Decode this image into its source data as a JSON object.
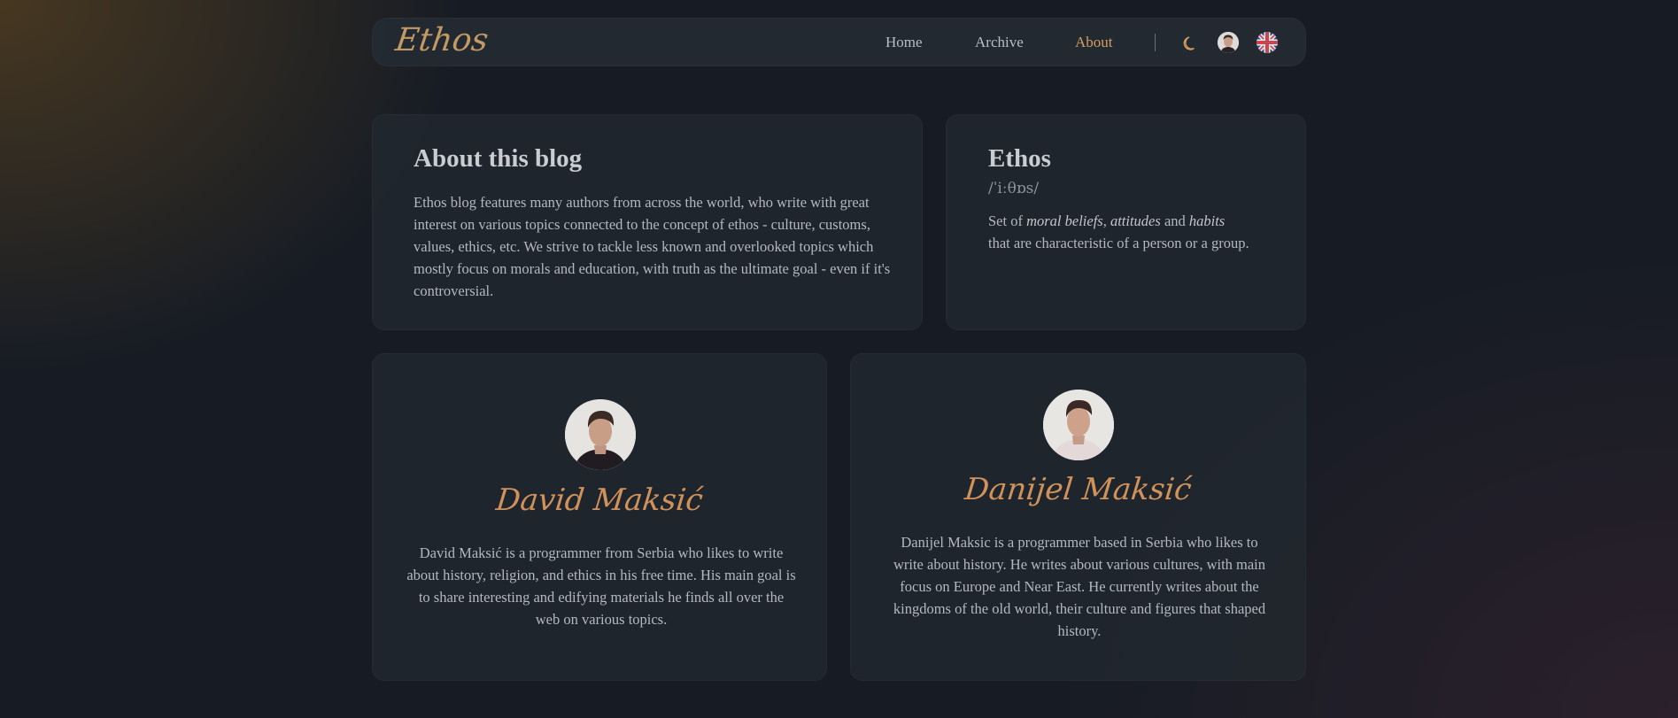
{
  "nav": {
    "logo": "Ethos",
    "links": [
      {
        "label": "Home"
      },
      {
        "label": "Archive"
      },
      {
        "label": "About"
      }
    ],
    "active_link": "About",
    "accent_color": "#d49d5f",
    "theme_icon": "moon-icon",
    "language_icon": "uk-flag-icon",
    "profile_icon": "user-avatar"
  },
  "about": {
    "title": "About this blog",
    "text": "Ethos blog features many authors from across the world, who write with great interest on various topics connected to the concept of ethos - culture, customs, values, ethics, etc. We strive to tackle less known and overlooked topics which mostly focus on morals and education, with truth as the ultimate goal - even if it's controversial."
  },
  "definition": {
    "term": "Ethos",
    "pronunciation": "/ˈiːθɒs/",
    "prefix": "Set of ",
    "em1": "moral beliefs",
    "sep1": ", ",
    "em2": "attitudes",
    "sep2": " and ",
    "em3": "habits",
    "suffix": "that are characteristic of a person or a group."
  },
  "authors": [
    {
      "name": "David Maksić",
      "bio": "David Maksić is a programmer from Serbia who likes to write about history, religion, and ethics in his free time. His main goal is to share interesting and edifying materials he finds all over the web on various topics."
    },
    {
      "name": "Danijel Maksić",
      "bio": "Danijel Maksic is a programmer based in Serbia who likes to write about history. He writes about various cultures, with main focus on Europe and Near East. He currently writes about the kingdoms of the old world, their culture and figures that shaped history."
    }
  ]
}
